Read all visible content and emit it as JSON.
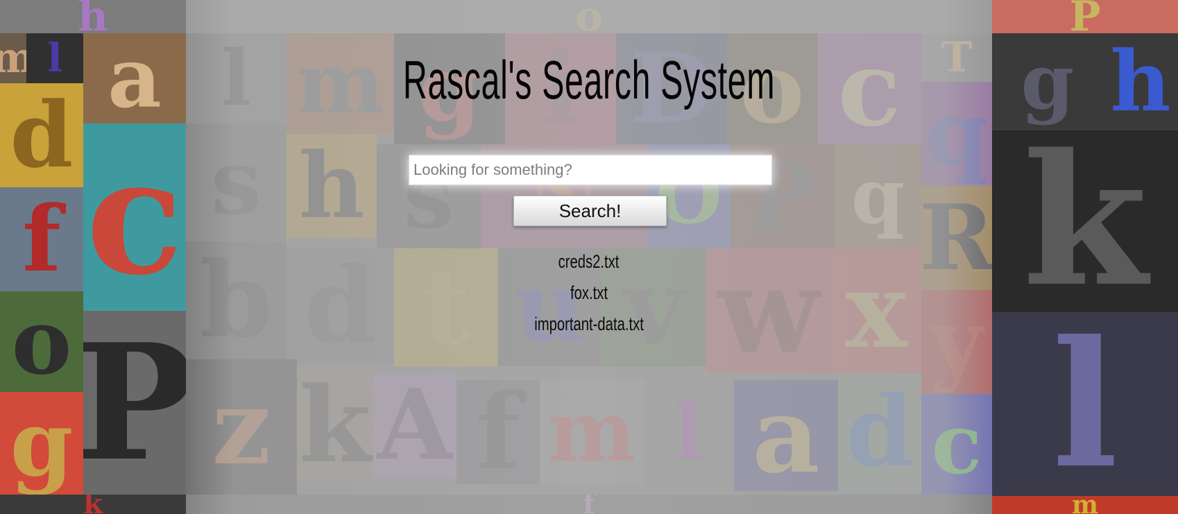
{
  "header": {
    "title": "Rascal's Search System"
  },
  "search": {
    "placeholder": "Looking for something?",
    "value": "",
    "button_label": "Search!"
  },
  "results": [
    {
      "label": "creds2.txt"
    },
    {
      "label": "fox.txt"
    },
    {
      "label": "important-data.txt"
    }
  ],
  "background_letters": [
    "m",
    "l",
    "a",
    "d",
    "c",
    "f",
    "o",
    "P",
    "g",
    "h",
    "k",
    "l",
    "m",
    "g",
    "i",
    "D",
    "o",
    "c",
    "T",
    "q",
    "h",
    "s",
    "N",
    "O",
    "P",
    "q",
    "R",
    "s",
    "b",
    "d",
    "t",
    "u",
    "v",
    "w",
    "x",
    "y",
    "z",
    "k",
    "A",
    "f"
  ],
  "colors": {
    "background": "#7a7a7a",
    "overlay": "#b2b2b2",
    "title": "#050505",
    "button_top": "#ffffff",
    "button_bottom": "#d9d9d9"
  }
}
